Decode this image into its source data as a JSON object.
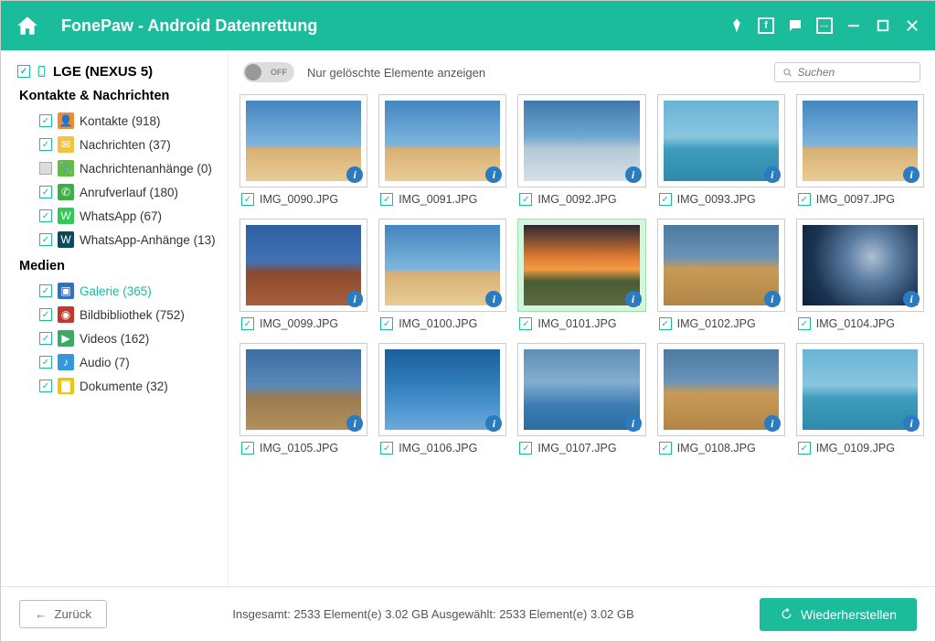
{
  "app_title": "FonePaw - Android Datenrettung",
  "device": {
    "name": "LGE (NEXUS 5)"
  },
  "sidebar": {
    "section1": "Kontakte & Nachrichten",
    "section2": "Medien",
    "items1": [
      {
        "label": "Kontakte (918)",
        "checked": true,
        "color": "#f28b30",
        "glyph": "👤"
      },
      {
        "label": "Nachrichten (37)",
        "checked": true,
        "color": "#f6c13c",
        "glyph": "✉"
      },
      {
        "label": "Nachrichtenanhänge (0)",
        "checked": false,
        "color": "#5fbf3d",
        "glyph": "📎"
      },
      {
        "label": "Anrufverlauf (180)",
        "checked": true,
        "color": "#3fae4a",
        "glyph": "✆"
      },
      {
        "label": "WhatsApp (67)",
        "checked": true,
        "color": "#34c759",
        "glyph": "W"
      },
      {
        "label": "WhatsApp-Anhänge (13)",
        "checked": true,
        "color": "#0b4a5c",
        "glyph": "W"
      }
    ],
    "items2": [
      {
        "label": "Galerie (365)",
        "checked": true,
        "active": true,
        "color": "#2f72c4",
        "glyph": "▣"
      },
      {
        "label": "Bildbibliothek (752)",
        "checked": true,
        "color": "#c0392b",
        "glyph": "◉"
      },
      {
        "label": "Videos (162)",
        "checked": true,
        "color": "#3ba864",
        "glyph": "▶"
      },
      {
        "label": "Audio (7)",
        "checked": true,
        "color": "#3498db",
        "glyph": "♪"
      },
      {
        "label": "Dokumente (32)",
        "checked": true,
        "color": "#f1c40f",
        "glyph": "▇"
      }
    ]
  },
  "toolbar": {
    "toggle_state": "OFF",
    "toggle_label": "Nur gelöschte Elemente anzeigen",
    "search_placeholder": "Suchen"
  },
  "thumbnails": [
    {
      "name": "IMG_0090.JPG",
      "cls": "sky1"
    },
    {
      "name": "IMG_0091.JPG",
      "cls": "sky1"
    },
    {
      "name": "IMG_0092.JPG",
      "cls": "sky2"
    },
    {
      "name": "IMG_0093.JPG",
      "cls": "sea"
    },
    {
      "name": "IMG_0097.JPG",
      "cls": "sky1"
    },
    {
      "name": "IMG_0099.JPG",
      "cls": "rock"
    },
    {
      "name": "IMG_0100.JPG",
      "cls": "sky1"
    },
    {
      "name": "IMG_0101.JPG",
      "cls": "sunset",
      "selected": true
    },
    {
      "name": "IMG_0102.JPG",
      "cls": "medina"
    },
    {
      "name": "IMG_0104.JPG",
      "cls": "night"
    },
    {
      "name": "IMG_0105.JPG",
      "cls": "plaza"
    },
    {
      "name": "IMG_0106.JPG",
      "cls": "blue1"
    },
    {
      "name": "IMG_0107.JPG",
      "cls": "blue2"
    },
    {
      "name": "IMG_0108.JPG",
      "cls": "medina"
    },
    {
      "name": "IMG_0109.JPG",
      "cls": "sea"
    }
  ],
  "footer": {
    "back": "Zurück",
    "stats": "Insgesamt: 2533 Element(e) 3.02 GB   Ausgewählt: 2533 Element(e) 3.02 GB",
    "recover": "Wiederherstellen"
  }
}
